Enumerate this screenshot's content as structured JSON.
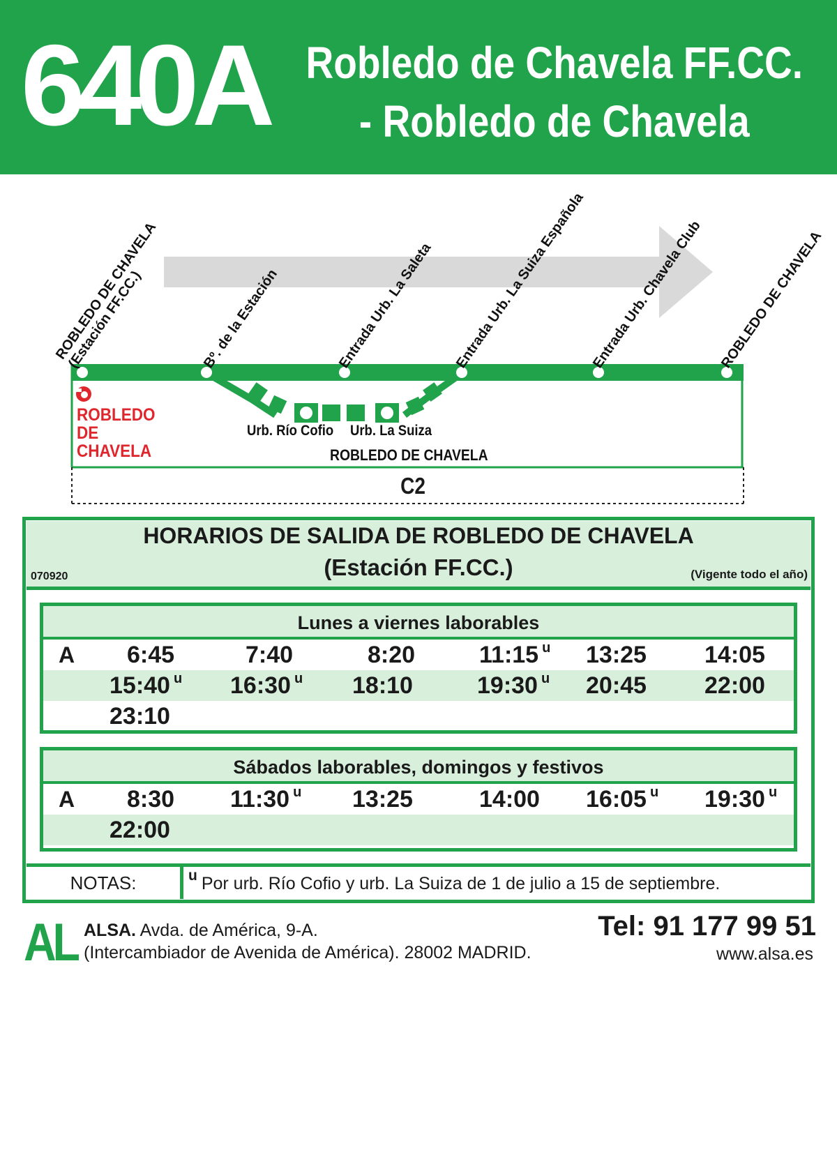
{
  "header": {
    "route_number": "640A",
    "title_line1": "Robledo de Chavela FF.CC.",
    "title_line2": "- Robledo de Chavela"
  },
  "diagram": {
    "stops": [
      {
        "line1": "ROBLEDO DE CHAVELA",
        "line2": "(Estación FF.CC.)"
      },
      {
        "line1": "Bº. de la Estación",
        "line2": ""
      },
      {
        "line1": "Entrada Urb. La Saleta",
        "line2": ""
      },
      {
        "line1": "Entrada Urb. La Suiza Española",
        "line2": ""
      },
      {
        "line1": "Entrada Urb. Chavela Club",
        "line2": ""
      },
      {
        "line1": "ROBLEDO DE CHAVELA",
        "line2": ""
      }
    ],
    "loop_stops": [
      "Urb. Río Cofio",
      "Urb. La Suiza"
    ],
    "municipality_start": "ROBLEDO DE CHAVELA",
    "municipality_main": "ROBLEDO DE CHAVELA",
    "zone": "C2",
    "colors": {
      "line": "#21a34c",
      "arrow": "#d9d9d9",
      "station": "#e0262d"
    }
  },
  "schedule": {
    "title": "HORARIOS DE SALIDA DE ROBLEDO DE CHAVELA",
    "subtitle": "(Estación FF.CC.)",
    "code": "070920",
    "validity": "(Vigente todo el año)",
    "weekdays": {
      "heading": "Lunes a viernes laborables",
      "row_label": "A",
      "rows": [
        [
          {
            "t": "6:45",
            "n": ""
          },
          {
            "t": "7:40",
            "n": ""
          },
          {
            "t": "8:20",
            "n": ""
          },
          {
            "t": "11:15",
            "n": "u"
          },
          {
            "t": "13:25",
            "n": ""
          },
          {
            "t": "14:05",
            "n": ""
          }
        ],
        [
          {
            "t": "15:40",
            "n": "u"
          },
          {
            "t": "16:30",
            "n": "u"
          },
          {
            "t": "18:10",
            "n": ""
          },
          {
            "t": "19:30",
            "n": "u"
          },
          {
            "t": "20:45",
            "n": ""
          },
          {
            "t": "22:00",
            "n": ""
          }
        ],
        [
          {
            "t": "23:10",
            "n": ""
          }
        ]
      ]
    },
    "weekends": {
      "heading": "Sábados laborables, domingos y festivos",
      "row_label": "A",
      "rows": [
        [
          {
            "t": "8:30",
            "n": ""
          },
          {
            "t": "11:30",
            "n": "u"
          },
          {
            "t": "13:25",
            "n": ""
          },
          {
            "t": "14:00",
            "n": ""
          },
          {
            "t": "16:05",
            "n": "u"
          },
          {
            "t": "19:30",
            "n": "u"
          }
        ],
        [
          {
            "t": "22:00",
            "n": ""
          }
        ]
      ]
    },
    "notes_label": "NOTAS:",
    "note_mark": "u",
    "note_text": "Por urb. Río Cofio y urb. La Suiza de 1 de julio a 15 de septiembre."
  },
  "footer": {
    "logo": "AL",
    "company": "ALSA.",
    "address1": "Avda. de América, 9-A.",
    "address2": "(Intercambiador de Avenida de América). 28002 MADRID.",
    "phone": "Tel: 91 177 99 51",
    "website": "www.alsa.es"
  }
}
